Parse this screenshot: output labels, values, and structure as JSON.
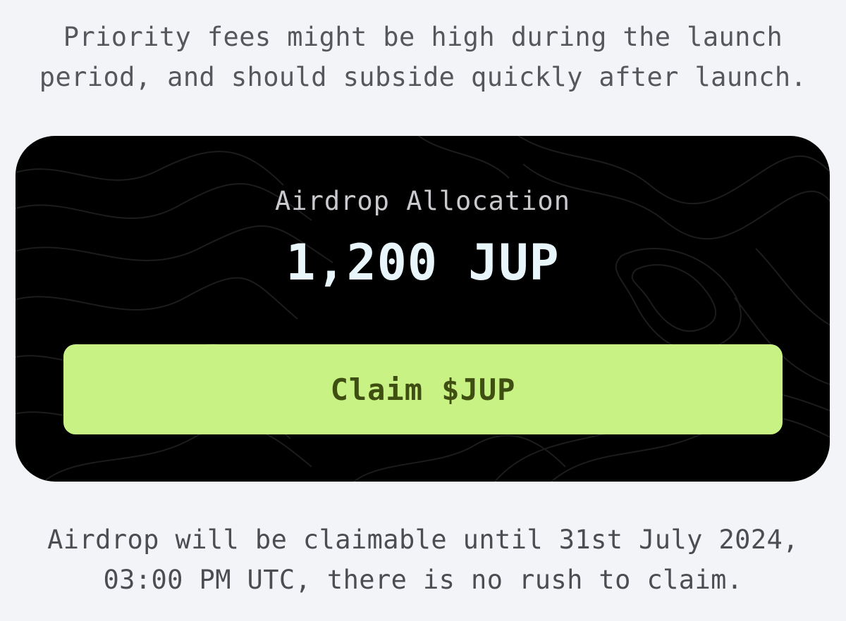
{
  "top_notice": {
    "line1": "Priority fees might be high during the launch",
    "line2": "period, and should subside quickly after launch."
  },
  "card": {
    "label": "Airdrop Allocation",
    "amount": "1,200 JUP",
    "button_label": "Claim $JUP"
  },
  "bottom_notice": {
    "line1": "Airdrop will be claimable until 31st July 2024,",
    "line2": "03:00 PM UTC, there is no rush to claim."
  },
  "colors": {
    "page_background": "#f3f4f8",
    "card_background": "#000000",
    "button_background": "#c8f284",
    "button_text": "#3f4f12",
    "amount_text": "#e8f5fb"
  }
}
